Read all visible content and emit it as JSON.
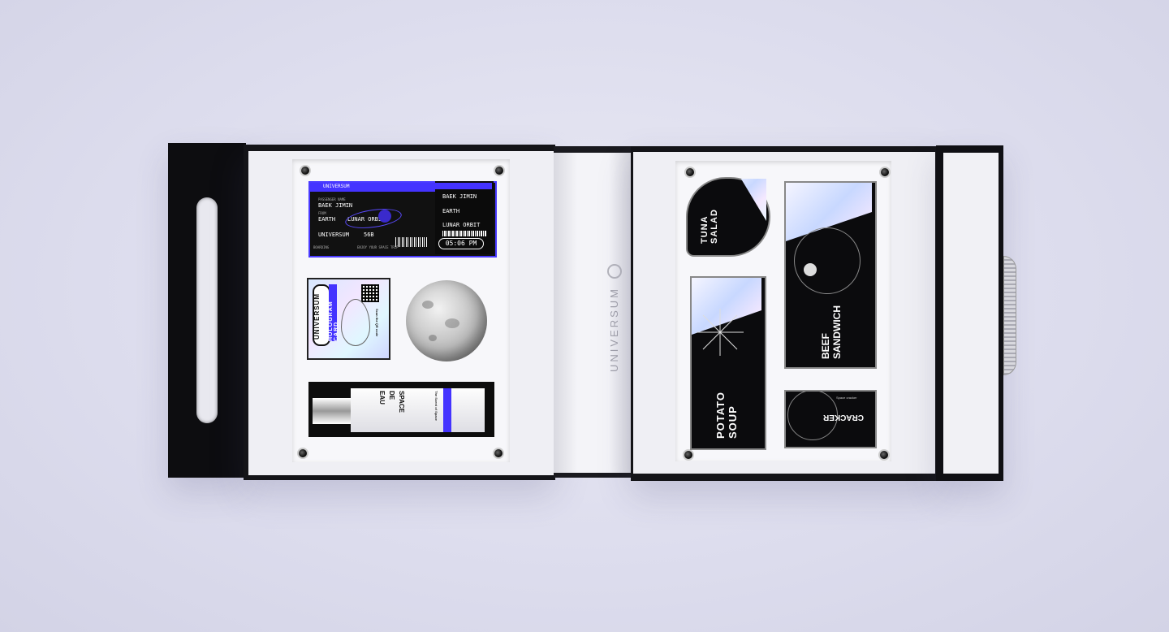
{
  "brand": "UNIVERSUM",
  "ticket": {
    "brand": "UNIVERSUM",
    "passenger_label": "PASSENGER NAME",
    "passenger": "BAEK JIMIN",
    "from_label": "FROM",
    "from": "EARTH",
    "to": "LUNAR ORBIT",
    "flight": "UNIVERSUM",
    "seat": "56B",
    "stub_passenger": "BAEK JIMIN",
    "stub_from": "EARTH",
    "stub_to": "LUNAR ORBIT",
    "time": "05:06 PM",
    "footer_left": "BOARDING",
    "footer_right": "ENJOY YOUR SPACE TRIP"
  },
  "hologram_card": {
    "brand": "UNIVERSUM",
    "title": "HOLOGRAM CARD",
    "qr_hint": "Scan the QR code"
  },
  "bottle": {
    "name_1": "EAU",
    "name_2": "DE",
    "name_3": "SPACE",
    "tagline": "The Scent of Space"
  },
  "foods": {
    "tuna": "TUNA SALAD",
    "beef": "BEEF SANDWICH",
    "potato": "POTATO SOUP",
    "cracker": "CRACKER",
    "cracker_sub": "Space cracker"
  },
  "colors": {
    "accent": "#4433ff",
    "box": "#121216",
    "tray": "#f7f7fa"
  }
}
